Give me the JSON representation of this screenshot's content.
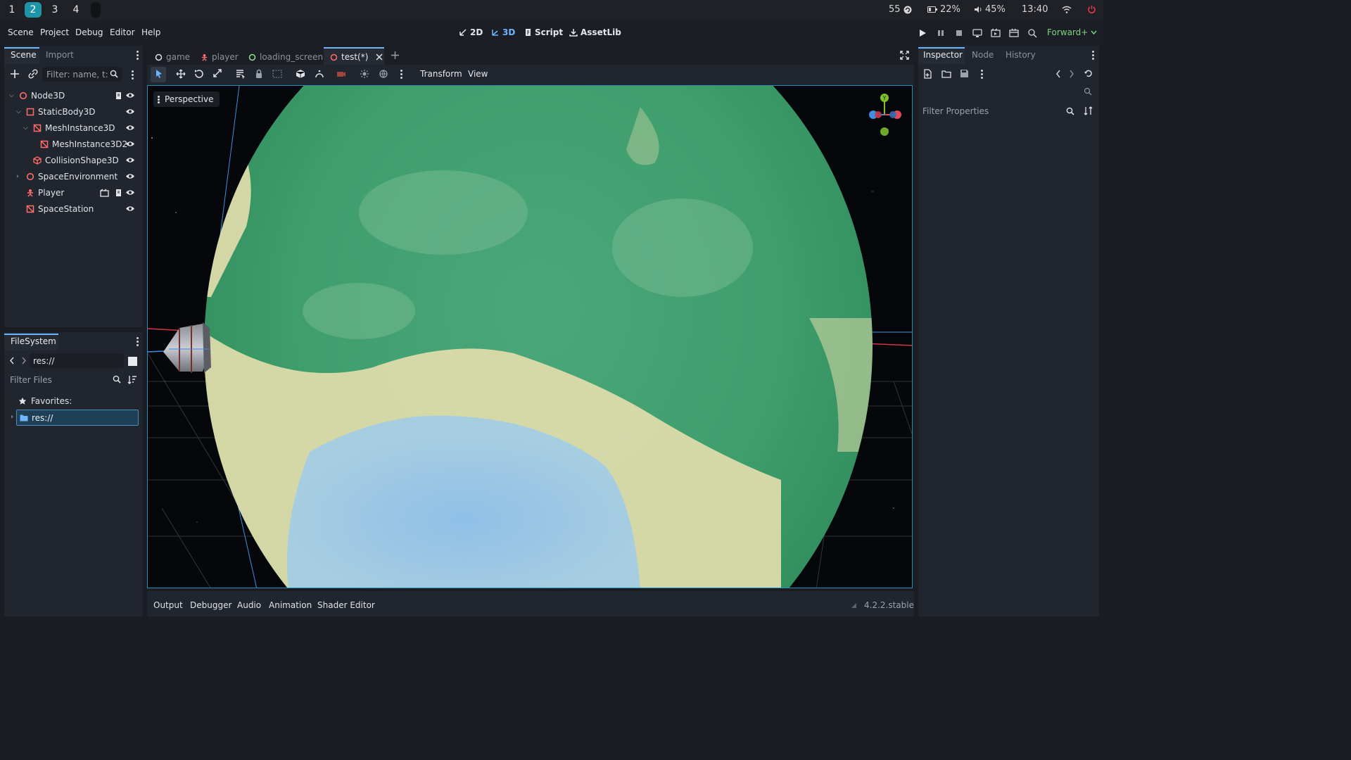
{
  "system_bar": {
    "workspaces": [
      "1",
      "2",
      "3",
      "4"
    ],
    "active_workspace": "2",
    "updates": "55",
    "battery": "22%",
    "volume": "45%",
    "time": "13:40"
  },
  "menubar": {
    "menus": [
      "Scene",
      "Project",
      "Debug",
      "Editor",
      "Help"
    ],
    "modes": {
      "m2d": "2D",
      "m3d": "3D",
      "script": "Script",
      "assetlib": "AssetLib"
    },
    "active_mode": "3D",
    "renderer": "Forward+"
  },
  "scene_dock": {
    "tabs": {
      "scene": "Scene",
      "import": "Import"
    },
    "filter_placeholder": "Filter: name, t:ty",
    "nodes": [
      {
        "name": "Node3D"
      },
      {
        "name": "StaticBody3D"
      },
      {
        "name": "MeshInstance3D"
      },
      {
        "name": "MeshInstance3D2"
      },
      {
        "name": "CollisionShape3D"
      },
      {
        "name": "SpaceEnvironment"
      },
      {
        "name": "Player"
      },
      {
        "name": "SpaceStation"
      }
    ]
  },
  "filesystem_dock": {
    "title": "FileSystem",
    "path": "res://",
    "filter_placeholder": "Filter Files",
    "favorites_label": "Favorites:",
    "root_label": "res://"
  },
  "doc_tabs": [
    {
      "label": "game"
    },
    {
      "label": "player"
    },
    {
      "label": "loading_screen"
    },
    {
      "label": "test(*)"
    }
  ],
  "viewport": {
    "toolbar": {
      "transform": "Transform",
      "view": "View"
    },
    "perspective_label": "Perspective",
    "gizmo_y": "Y"
  },
  "inspector": {
    "tabs": {
      "inspector": "Inspector",
      "node": "Node",
      "history": "History"
    },
    "filter_placeholder": "Filter Properties"
  },
  "bottom_panel": {
    "tabs": [
      "Output",
      "Debugger",
      "Audio",
      "Animation",
      "Shader Editor"
    ],
    "version": "4.2.2.stable"
  },
  "colors": {
    "accent": "#1f95a8",
    "selection": "#2b8fb5",
    "node_red": "#ff6b6b",
    "planet_green": "#3f9e6c"
  }
}
